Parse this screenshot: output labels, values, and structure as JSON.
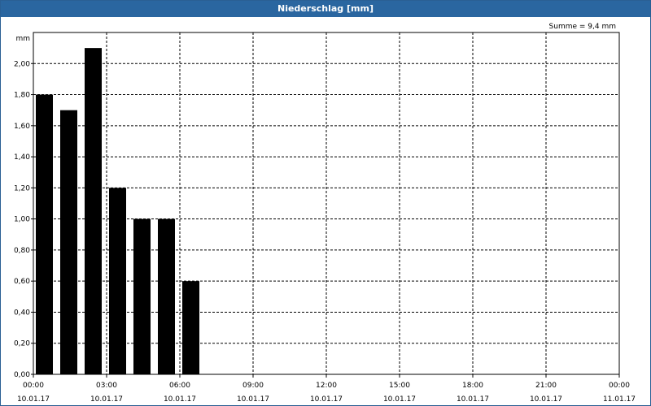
{
  "window": {
    "title": "Niederschlag [mm]"
  },
  "chart_data": {
    "type": "bar",
    "title": "Niederschlag [mm]",
    "ylabel": "mm",
    "annotation": "Summe = 9,4 mm",
    "x_range_hours": [
      0,
      24
    ],
    "ylim": [
      0,
      2.2
    ],
    "y_ticks": [
      0,
      0.2,
      0.4,
      0.6,
      0.8,
      1.0,
      1.2,
      1.4,
      1.6,
      1.8,
      2.0
    ],
    "y_tick_labels": [
      "0,00",
      "0,20",
      "0,40",
      "0,60",
      "0,80",
      "1,00",
      "1,20",
      "1,40",
      "1,60",
      "1,80",
      "2,00"
    ],
    "x_ticks": [
      {
        "hour": 0,
        "time": "00:00",
        "date": "10.01.17"
      },
      {
        "hour": 3,
        "time": "03:00",
        "date": "10.01.17"
      },
      {
        "hour": 6,
        "time": "06:00",
        "date": "10.01.17"
      },
      {
        "hour": 9,
        "time": "09:00",
        "date": "10.01.17"
      },
      {
        "hour": 12,
        "time": "12:00",
        "date": "10.01.17"
      },
      {
        "hour": 15,
        "time": "15:00",
        "date": "10.01.17"
      },
      {
        "hour": 18,
        "time": "18:00",
        "date": "10.01.17"
      },
      {
        "hour": 21,
        "time": "21:00",
        "date": "10.01.17"
      },
      {
        "hour": 24,
        "time": "00:00",
        "date": "11.01.17"
      }
    ],
    "bars": [
      {
        "hour": 0,
        "value": 1.8
      },
      {
        "hour": 1,
        "value": 1.7
      },
      {
        "hour": 2,
        "value": 2.1
      },
      {
        "hour": 3,
        "value": 1.2
      },
      {
        "hour": 4,
        "value": 1.0
      },
      {
        "hour": 5,
        "value": 1.0
      },
      {
        "hour": 6,
        "value": 0.6
      }
    ],
    "bar_color": "#000000",
    "grid": true,
    "grid_style": "dashed",
    "legend": "none"
  }
}
